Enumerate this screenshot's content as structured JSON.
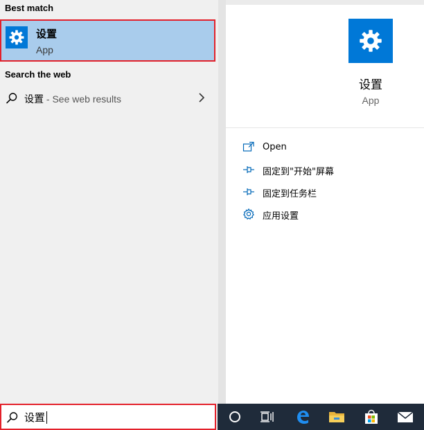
{
  "results": {
    "best_match_header": "Best match",
    "best_match": {
      "name": "设置",
      "type": "App",
      "icon": "gear-icon",
      "tile_color": "#0078d7"
    },
    "web_header": "Search the web",
    "web_result": {
      "query": "设置",
      "suffix": " - See web results",
      "icon": "search-icon",
      "chevron_icon": "chevron-right-icon"
    }
  },
  "detail": {
    "title": "设置",
    "subtitle": "App",
    "icon": "gear-icon",
    "actions": [
      {
        "label": "Open",
        "icon": "open-icon"
      },
      {
        "label": "固定到\"开始\"屏幕",
        "icon": "pin-icon"
      },
      {
        "label": "固定到任务栏",
        "icon": "pin-icon"
      },
      {
        "label": "应用设置",
        "icon": "gear-icon"
      }
    ]
  },
  "search": {
    "value": "设置",
    "icon": "search-icon"
  },
  "taskbar": {
    "items": [
      {
        "icon": "cortana-icon"
      },
      {
        "icon": "task-view-icon"
      },
      {
        "icon": "edge-icon"
      },
      {
        "icon": "file-explorer-icon"
      },
      {
        "icon": "store-icon"
      },
      {
        "icon": "mail-icon"
      }
    ]
  },
  "colors": {
    "accent": "#0078d7",
    "highlight": "#a9ccec",
    "focus_border": "#e3202a",
    "taskbar": "#1f2b3a"
  }
}
